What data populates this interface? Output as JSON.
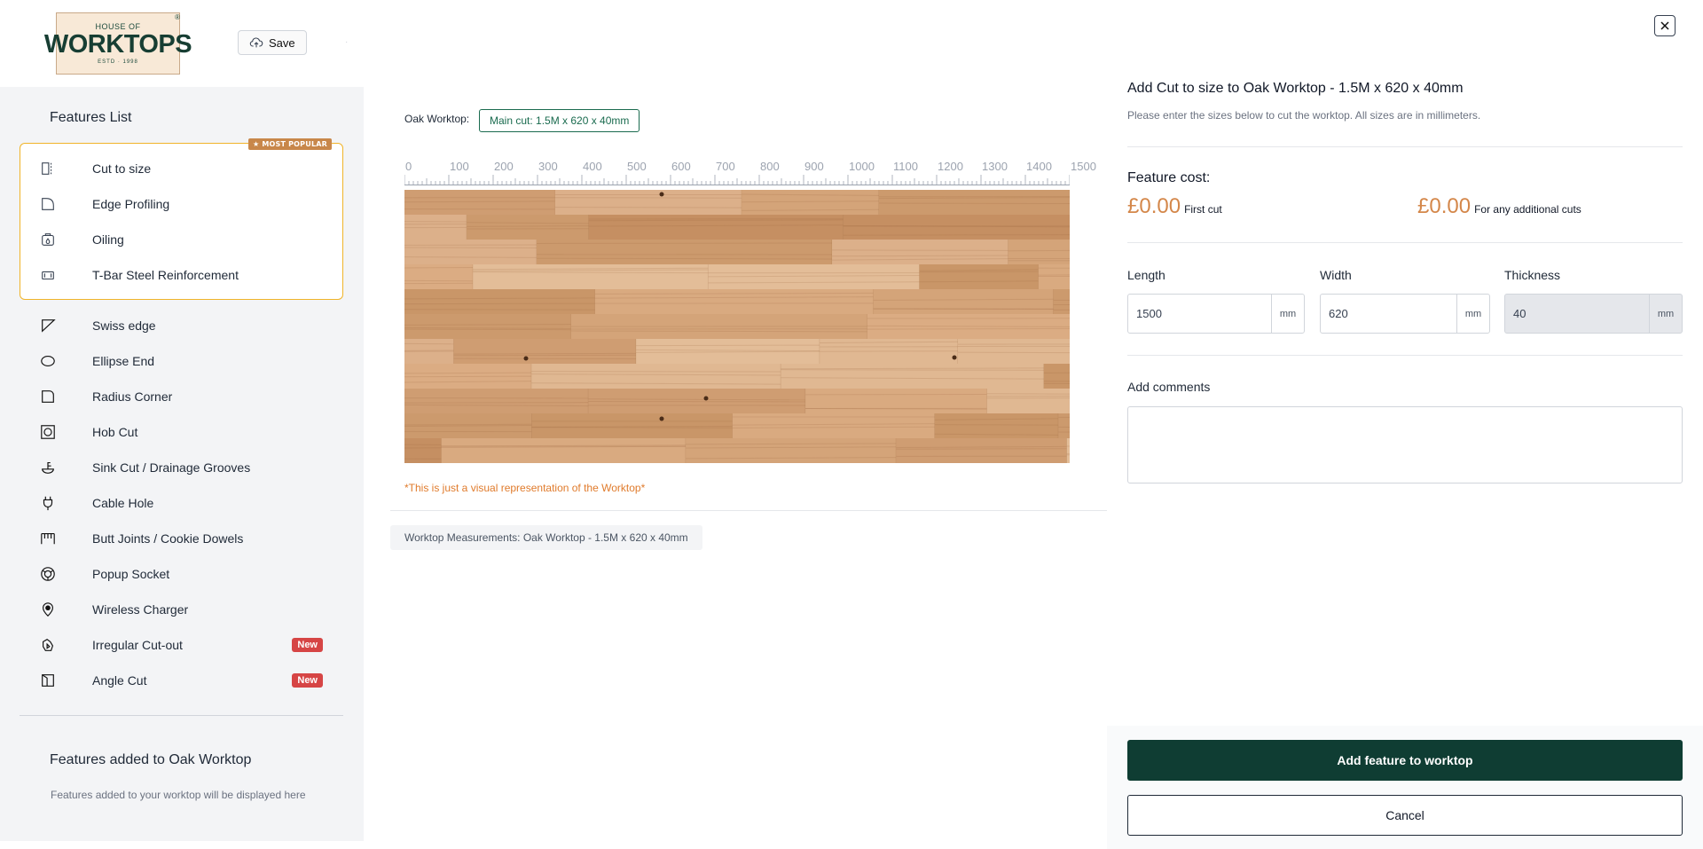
{
  "brand": {
    "logo_top": "HOUSE OF",
    "logo_name": "WORKTOPS",
    "logo_sub": "ESTD · 1998"
  },
  "header": {
    "save_label": "Save"
  },
  "sidebar": {
    "title": "Features List",
    "popular_badge": "★ MOST POPULAR",
    "popular_items": [
      {
        "label": "Cut to size",
        "icon": "cut-to-size-icon"
      },
      {
        "label": "Edge Profiling",
        "icon": "edge-profiling-icon"
      },
      {
        "label": "Oiling",
        "icon": "oiling-icon"
      },
      {
        "label": "T-Bar Steel Reinforcement",
        "icon": "tbar-icon"
      }
    ],
    "items": [
      {
        "label": "Swiss edge",
        "icon": "swiss-edge-icon"
      },
      {
        "label": "Ellipse End",
        "icon": "ellipse-end-icon"
      },
      {
        "label": "Radius Corner",
        "icon": "radius-corner-icon"
      },
      {
        "label": "Hob Cut",
        "icon": "hob-cut-icon"
      },
      {
        "label": "Sink Cut / Drainage Grooves",
        "icon": "sink-cut-icon"
      },
      {
        "label": "Cable Hole",
        "icon": "cable-hole-icon"
      },
      {
        "label": "Butt Joints / Cookie Dowels",
        "icon": "butt-joints-icon"
      },
      {
        "label": "Popup Socket",
        "icon": "popup-socket-icon"
      },
      {
        "label": "Wireless Charger",
        "icon": "wireless-charger-icon"
      },
      {
        "label": "Irregular Cut-out",
        "icon": "irregular-cutout-icon",
        "badge": "New"
      },
      {
        "label": "Angle Cut",
        "icon": "angle-cut-icon",
        "badge": "New"
      }
    ],
    "added_title": "Features added to Oak Worktop",
    "added_sub": "Features added to your worktop will be displayed here"
  },
  "main": {
    "worktop_label": "Oak Worktop:",
    "main_cut": "Main cut: 1.5M x 620 x 40mm",
    "ruler_labels": [
      "0",
      "100",
      "200",
      "300",
      "400",
      "500",
      "600",
      "700",
      "800",
      "900",
      "1000",
      "1100",
      "1200",
      "1300",
      "1400",
      "1500"
    ],
    "disclaimer": "*This is just a visual representation of the Worktop*",
    "measurements": "Worktop Measurements: Oak Worktop - 1.5M x 620 x 40mm"
  },
  "panel": {
    "title": "Add Cut to size to Oak Worktop - 1.5M x 620 x 40mm",
    "subtitle": "Please enter the sizes below to cut the worktop. All sizes are in millimeters.",
    "cost_label": "Feature cost:",
    "first_price": "£0.00",
    "first_note": "First cut",
    "additional_price": "£0.00",
    "additional_note": "For any additional cuts",
    "length_label": "Length",
    "length_value": "1500",
    "width_label": "Width",
    "width_value": "620",
    "thickness_label": "Thickness",
    "thickness_value": "40",
    "unit": "mm",
    "comments_label": "Add comments",
    "add_button": "Add feature to worktop",
    "cancel_button": "Cancel"
  },
  "colors": {
    "accent_dark": "#0f3d33",
    "accent_green": "#1a6b4f",
    "price_orange": "#d4874a",
    "popular_border": "#f0b429",
    "new_badge": "#d64545"
  }
}
